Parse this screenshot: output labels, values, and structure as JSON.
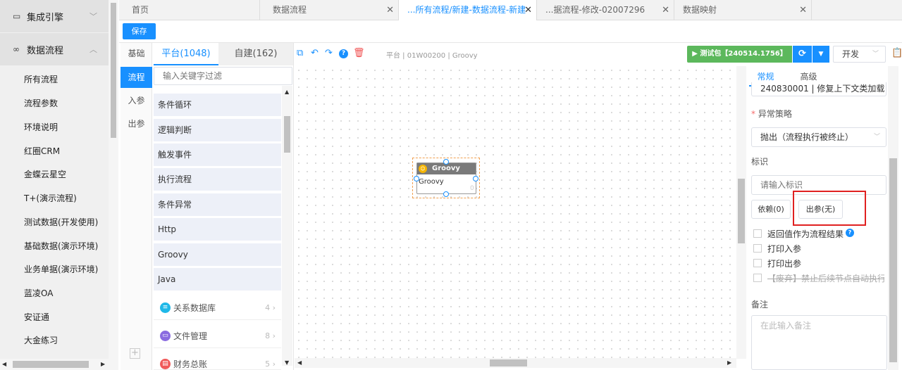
{
  "sidebar": {
    "groups": [
      {
        "icon": "monitor-icon",
        "icon_glyph": "▭",
        "label": "集成引擎",
        "chevron": "﹀"
      },
      {
        "icon": "infinity-icon",
        "icon_glyph": "∞",
        "label": "数据流程",
        "chevron": "︿"
      }
    ],
    "items": [
      "所有流程",
      "流程参数",
      "环境说明",
      "红圈CRM",
      "金蝶云星空",
      "T+(演示流程)",
      "测试数据(开发使用)",
      "基础数据(演示环境)",
      "业务单据(演示环境)",
      "蓝凌OA",
      "安证通",
      "大金练习"
    ]
  },
  "tabs": [
    {
      "label": "首页",
      "closable": false
    },
    {
      "label": "数据流程",
      "closable": true
    },
    {
      "label": "...所有流程/新建-数据流程-新建",
      "closable": true,
      "active": true
    },
    {
      "label": "...据流程-修改-02007296",
      "closable": true
    },
    {
      "label": "数据映射",
      "closable": true
    }
  ],
  "close_glyph": "✕",
  "toolbar": {
    "save_label": "保存"
  },
  "vertical_tabs": [
    {
      "label": "基础"
    },
    {
      "label": "流程",
      "active": true
    },
    {
      "label": "入参"
    },
    {
      "label": "出参"
    }
  ],
  "palette": {
    "tab_platform": "平台(1048)",
    "tab_custom": "自建(162)",
    "filter_placeholder": "输入关键字过滤",
    "items": [
      "条件循环",
      "逻辑判断",
      "触发事件",
      "执行流程",
      "条件异常",
      "Http",
      "Groovy",
      "Java"
    ],
    "groups": [
      {
        "label": "关系数据库",
        "count": "4",
        "icon": "database-icon",
        "color": "#1fb8e8"
      },
      {
        "label": "文件管理",
        "count": "8",
        "icon": "folder-icon",
        "color": "#8a6be0"
      },
      {
        "label": "财务总账",
        "count": "5",
        "icon": "ledger-icon",
        "color": "#f05a5a"
      }
    ],
    "add_label": "+"
  },
  "canvas": {
    "breadcrumb": "平台 | 01W00200 | Groovy",
    "node": {
      "title": "Groovy",
      "body": "Groovy",
      "counter": "0"
    }
  },
  "header_actions": {
    "test_package_label": "▶ 测试包【240514.1756】",
    "env_select_value": "开发"
  },
  "properties": {
    "tab_basic": "常规",
    "tab_advanced": "高级",
    "version_value": "240830001 | 修复上下文类加载",
    "exception_label": "异常策略",
    "exception_value": "抛出（流程执行被终止）",
    "identifier_label": "标识",
    "identifier_placeholder": "请输入标识",
    "depend_button": "依赖(0)",
    "outparam_button": "出参(无)",
    "checkboxes": [
      {
        "label": "返回值作为流程结果",
        "checked": false
      },
      {
        "label": "打印入参",
        "checked": false
      },
      {
        "label": "打印出参",
        "checked": false
      },
      {
        "label": "【废弃】禁止后续节点自动执行",
        "checked": false,
        "deprecated": true
      }
    ],
    "notes_label": "备注",
    "notes_placeholder": "在此输入备注"
  },
  "colors": {
    "accent": "#1890ff",
    "success": "#5cb85c",
    "highlight": "#e02020"
  }
}
